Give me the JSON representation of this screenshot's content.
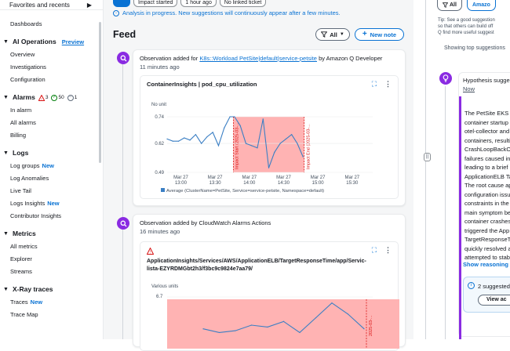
{
  "sidebar": {
    "favorites": "Favorites and recents",
    "dashboards": "Dashboards",
    "ai_ops": {
      "title": "AI Operations",
      "preview": "Preview",
      "items": [
        "Overview",
        "Investigations",
        "Configuration"
      ]
    },
    "alarms": {
      "title": "Alarms",
      "alarm_count": "3",
      "ok_count": "50",
      "insufficient_count": "1",
      "items": [
        "In alarm",
        "All alarms",
        "Billing"
      ]
    },
    "logs": {
      "title": "Logs",
      "items": [
        {
          "label": "Log groups",
          "badge": "New"
        },
        {
          "label": "Log Anomalies",
          "badge": ""
        },
        {
          "label": "Live Tail",
          "badge": ""
        },
        {
          "label": "Logs Insights",
          "badge": "New"
        },
        {
          "label": "Contributor Insights",
          "badge": ""
        }
      ]
    },
    "metrics": {
      "title": "Metrics",
      "items": [
        "All metrics",
        "Explorer",
        "Streams"
      ]
    },
    "xray": {
      "title": "X-Ray traces",
      "items": [
        {
          "label": "Traces",
          "badge": "New"
        },
        {
          "label": "Trace Map",
          "badge": ""
        }
      ]
    }
  },
  "top": {
    "pills": [
      "",
      "Impact started",
      "1 hour ago",
      "No linked ticket"
    ],
    "analysis": "Analysis in progress. New suggestions will continuously appear after a few minutes."
  },
  "feed": {
    "title": "Feed",
    "filter_label": "All",
    "new_note": "New note",
    "card1": {
      "prefix": "Observation added for",
      "link": "K8s::Workload PetSite|default|service-petsite",
      "suffix": "by Amazon Q Developer",
      "ago": "11 minutes ago",
      "widget_title": "ContainerInsights | pod_cpu_utilization",
      "unit": "No unit",
      "legend": "Average (ClusterName=PetSite, Service=service-petsite, Namespace=default)",
      "impact_start": "Impact Start (2025-03-...",
      "impact_end": "Impact End (2025-03-..."
    },
    "card2": {
      "title": "Observation added by CloudWatch Alarms Actions",
      "ago": "16 minutes ago",
      "metric_line1": "ApplicationInsights/Services/AWS/ApplicationELB/TargetResponseTime/app/Servic-",
      "metric_line2": "lista-EZYRDMGbt2h3/f3bc9c9824e7aa79/",
      "unit": "Various units",
      "ymax": "6.7",
      "impact_label": "2025-03-..."
    }
  },
  "chart_data": [
    {
      "type": "line",
      "title": "ContainerInsights | pod_cpu_utilization",
      "ylabel": "No unit",
      "ylim": [
        0.49,
        0.74
      ],
      "yticks": [
        "0.74",
        "0.62",
        "0.49"
      ],
      "xticks": [
        "Mar 27\n13:00",
        "Mar 27\n13:30",
        "Mar 27\n14:00",
        "Mar 27\n14:30",
        "Mar 27\n15:00",
        "Mar 27\n15:30"
      ],
      "impact_window": [
        "13:46",
        "14:48"
      ],
      "series": [
        {
          "name": "Average (ClusterName=PetSite, Service=service-petsite, Namespace=default)",
          "x": [
            "12:48",
            "12:53",
            "12:58",
            "13:03",
            "13:08",
            "13:13",
            "13:18",
            "13:23",
            "13:28",
            "13:33",
            "13:38",
            "13:43",
            "13:47",
            "13:52",
            "13:57",
            "14:02",
            "14:07",
            "14:12",
            "14:17",
            "14:22",
            "14:27",
            "14:32",
            "14:37",
            "14:42",
            "14:47"
          ],
          "values": [
            0.64,
            0.63,
            0.63,
            0.645,
            0.635,
            0.66,
            0.62,
            0.65,
            0.67,
            0.61,
            0.69,
            0.74,
            0.74,
            0.7,
            0.62,
            0.61,
            0.6,
            0.73,
            0.51,
            0.58,
            0.62,
            0.64,
            0.66,
            0.62,
            0.56
          ]
        }
      ]
    },
    {
      "type": "line",
      "ylabel": "Various units",
      "ylim_top": 6.7,
      "series": [
        {
          "name": "",
          "values": [
            5.9,
            5.8,
            5.85,
            6.0,
            5.95,
            6.1,
            5.8,
            6.2,
            6.6,
            6.3,
            5.9
          ]
        }
      ]
    }
  ],
  "right_panel": {
    "all_btn": "All",
    "amazon_btn": "Amazo",
    "tip": [
      "Tip: See a good suggestion",
      "so that others can build off",
      "Q find more useful suggest"
    ],
    "showing": "Showing top suggestions",
    "hypothesis": {
      "title": "Hypothesis sugges",
      "time": "Now",
      "lines": [
        "The PetSite EKS c",
        "container startup",
        "otel-collector and",
        "containers, resulti",
        "CrashLoopBackOf",
        "failures caused ins",
        "leading to a brief",
        "ApplicationELB Ta",
        "The root cause ap",
        "configuration issu",
        "constraints in the",
        "main symptom be",
        "container crashes.",
        "triggered the App",
        "TargetResponseTi",
        "quickly resolved a",
        "attempted to stab"
      ],
      "show_reasoning": "Show reasoning",
      "suggested": "2 suggested",
      "view": "View ac"
    }
  }
}
